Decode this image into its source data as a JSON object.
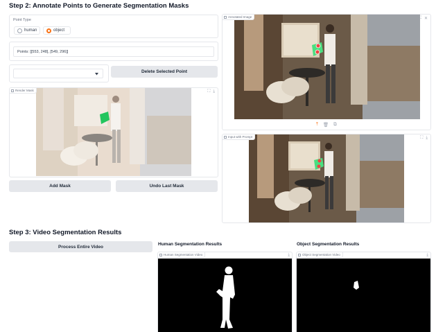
{
  "step2": {
    "title": "Step 2: Annotate Points to Generate Segmentation Masks",
    "point_type": {
      "label": "Point Type",
      "options": [
        {
          "label": "human",
          "selected": false
        },
        {
          "label": "object",
          "selected": true
        }
      ]
    },
    "points_text": "Points: [[553, 248], [549, 296]]",
    "dropdown_value": "",
    "delete_button": "Delete Selected Point",
    "render_mask_label": "Render Mask",
    "add_mask_button": "Add Mask",
    "undo_button": "Undo Last Mask",
    "annotated_image_label": "Annotated Image",
    "input_prompt_label": "Input with Prompt"
  },
  "step3": {
    "title": "Step 3: Video Segmentation Results",
    "process_button": "Process Entire Video",
    "human_title": "Human Segmentation Results",
    "human_video_label": "Human Segmentation Video",
    "object_title": "Object Segmentation Results",
    "object_video_label": "Object Segmentation Video"
  },
  "colors": {
    "accent": "#f97316",
    "button_bg": "#e5e7eb",
    "mask_green": "#22c55e"
  },
  "icons": [
    "image-icon",
    "fullscreen-icon",
    "close-icon",
    "download-icon",
    "upload-icon",
    "trash-icon",
    "copy-icon",
    "chevron-down-icon",
    "video-icon"
  ]
}
